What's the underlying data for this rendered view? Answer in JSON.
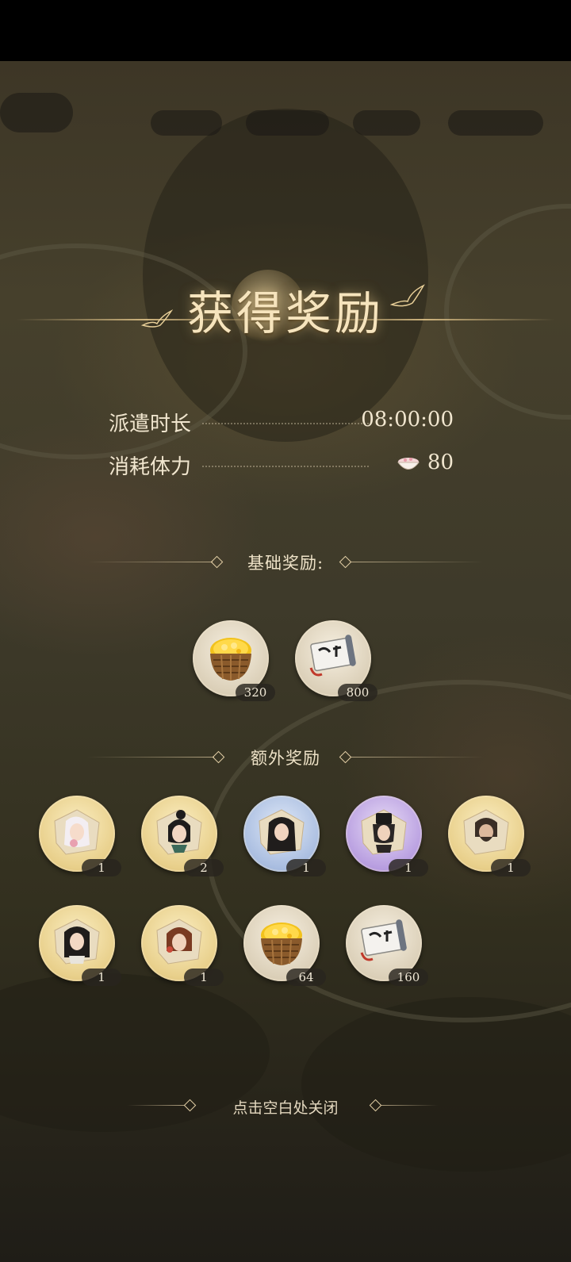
{
  "title": "获得奖励",
  "dispatch": {
    "duration_label": "派遣时长",
    "duration_value": "08:00:00",
    "stamina_label": "消耗体力",
    "stamina_value": "80",
    "stamina_icon": "rice-bowl-icon"
  },
  "basic_section": {
    "label": "基础奖励:",
    "rewards": [
      {
        "icon": "gold-coin-basket-icon",
        "count": "320",
        "rarity": "neutral"
      },
      {
        "icon": "embroidered-robe-scroll-icon",
        "count": "800",
        "rarity": "neutral"
      }
    ]
  },
  "extra_section": {
    "label": "额外奖励",
    "rewards": [
      {
        "icon": "character-portrait-white-hair-icon",
        "count": "1",
        "rarity": "gold"
      },
      {
        "icon": "character-portrait-topknot-icon",
        "count": "2",
        "rarity": "gold"
      },
      {
        "icon": "character-portrait-long-hair-icon",
        "count": "1",
        "rarity": "blue"
      },
      {
        "icon": "character-portrait-black-hat-icon",
        "count": "1",
        "rarity": "purple"
      },
      {
        "icon": "character-portrait-beard-icon",
        "count": "1",
        "rarity": "gold"
      },
      {
        "icon": "character-portrait-scholar-icon",
        "count": "1",
        "rarity": "gold"
      },
      {
        "icon": "character-portrait-red-hair-icon",
        "count": "1",
        "rarity": "gold"
      },
      {
        "icon": "gold-coin-basket-icon",
        "count": "64",
        "rarity": "neutral"
      },
      {
        "icon": "embroidered-robe-scroll-icon",
        "count": "160",
        "rarity": "neutral"
      }
    ]
  },
  "close_hint": "点击空白处关闭",
  "colors": {
    "title_glow": "#f6e4bd",
    "gold_frame": "#e8cf8a",
    "blue_frame": "#a9bde0",
    "purple_frame": "#b89ee0"
  }
}
